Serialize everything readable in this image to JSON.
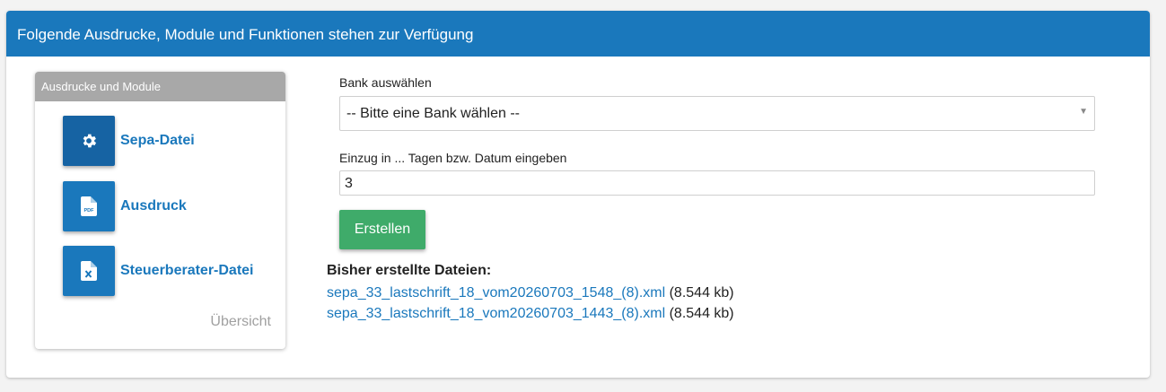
{
  "header": {
    "title": "Folgende Ausdrucke, Module und Funktionen stehen zur Verfügung"
  },
  "modules_card": {
    "title": "Ausdrucke und Module",
    "items": [
      {
        "label": "Sepa-Datei",
        "icon": "gear-icon"
      },
      {
        "label": "Ausdruck",
        "icon": "pdf-file-icon"
      },
      {
        "label": "Steuerberater-Datei",
        "icon": "excel-file-icon"
      }
    ],
    "overview_label": "Übersicht"
  },
  "form": {
    "bank_label": "Bank auswählen",
    "bank_selected": "-- Bitte eine Bank wählen --",
    "days_label": "Einzug in ... Tagen bzw. Datum eingeben",
    "days_value": "3",
    "submit_label": "Erstellen"
  },
  "files": {
    "title": "Bisher erstellte Dateien:",
    "items": [
      {
        "name": "sepa_33_lastschrift_18_vom20260703_1548_(8).xml",
        "size": "(8.544 kb)"
      },
      {
        "name": "sepa_33_lastschrift_18_vom20260703_1443_(8).xml",
        "size": "(8.544 kb)"
      }
    ]
  },
  "colors": {
    "primary": "#1a78bc",
    "success": "#3fab6a",
    "card_header": "#a8a8a8"
  }
}
